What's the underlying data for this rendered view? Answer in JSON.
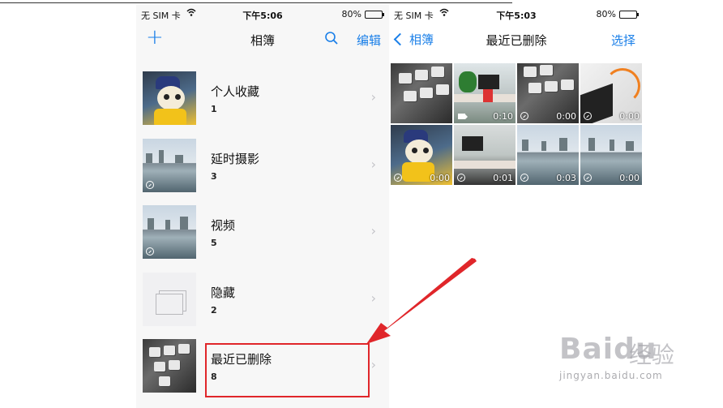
{
  "left_phone": {
    "status": {
      "carrier": "无 SIM 卡",
      "time": "下午5:06",
      "battery": "80%"
    },
    "nav": {
      "add_icon": "plus-icon",
      "title": "相簿",
      "search_icon": "search-icon",
      "edit": "编辑"
    },
    "albums": [
      {
        "name": "个人收藏",
        "count": "1"
      },
      {
        "name": "延时摄影",
        "count": "3"
      },
      {
        "name": "视频",
        "count": "5"
      },
      {
        "name": "隐藏",
        "count": "2"
      },
      {
        "name": "最近已删除",
        "count": "8"
      }
    ]
  },
  "right_phone": {
    "status": {
      "carrier": "无 SIM 卡",
      "time": "下午5:03",
      "battery": "80%"
    },
    "nav": {
      "back": "相簿",
      "title": "最近已删除",
      "select": "选择"
    },
    "grid": [
      {
        "duration": ""
      },
      {
        "duration": "0:10"
      },
      {
        "duration": "0:00"
      },
      {
        "duration": "0:00"
      },
      {
        "duration": "0:00"
      },
      {
        "duration": "0:01"
      },
      {
        "duration": "0:03"
      },
      {
        "duration": "0:00"
      }
    ]
  },
  "watermark": {
    "logo": "Baidu",
    "cn": "经验",
    "url": "jingyan.baidu.com"
  },
  "colors": {
    "accent": "#1a7fe8",
    "highlight": "#e0262a"
  }
}
